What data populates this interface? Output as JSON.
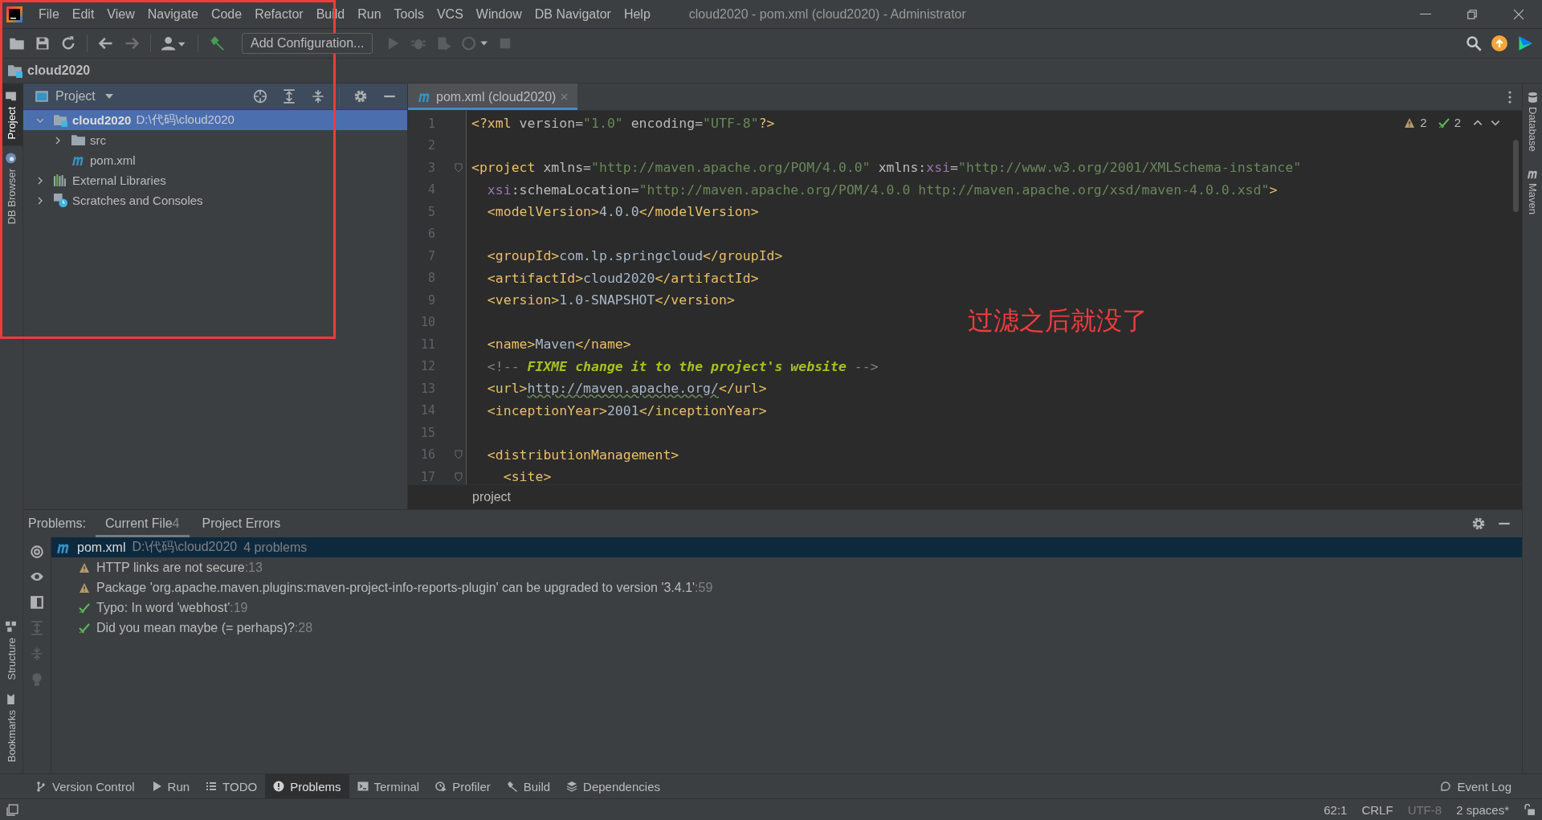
{
  "window": {
    "title": "cloud2020 - pom.xml (cloud2020) - Administrator"
  },
  "menu": [
    "File",
    "Edit",
    "View",
    "Navigate",
    "Code",
    "Refactor",
    "Build",
    "Run",
    "Tools",
    "VCS",
    "Window",
    "DB Navigator",
    "Help"
  ],
  "toolbar": {
    "run_config": "Add Configuration..."
  },
  "nav_bar": {
    "path": "cloud2020"
  },
  "left_stripe": {
    "top": [
      {
        "label": "Project",
        "selected": true,
        "kind": "folder"
      },
      {
        "label": "DB Browser",
        "selected": false,
        "kind": "db"
      }
    ],
    "bottom": [
      {
        "label": "Structure",
        "selected": false,
        "kind": "structure"
      },
      {
        "label": "Bookmarks",
        "selected": false,
        "kind": "bookmark"
      }
    ]
  },
  "right_stripe": [
    {
      "label": "Database",
      "kind": "db"
    },
    {
      "label": "Maven",
      "kind": "maven"
    }
  ],
  "project_panel": {
    "title": "Project",
    "tree": [
      {
        "label": "cloud2020",
        "path": "D:\\代码\\cloud2020",
        "kind": "module",
        "expanded": true,
        "selected": true,
        "children": [
          {
            "label": "src",
            "kind": "folder",
            "expanded": false,
            "selected": false
          },
          {
            "label": "pom.xml",
            "kind": "maven",
            "selected": false
          }
        ]
      },
      {
        "label": "External Libraries",
        "kind": "libraries",
        "expanded": false,
        "selected": false
      },
      {
        "label": "Scratches and Consoles",
        "kind": "scratches",
        "expanded": false,
        "selected": false
      }
    ]
  },
  "editor": {
    "tabs": [
      {
        "label": "pom.xml (cloud2020)",
        "selected": true
      }
    ],
    "warnings": "2",
    "typos": "2",
    "breadcrumb": "project",
    "lines": [
      {
        "number": "1",
        "fold": false,
        "tokens": [
          {
            "kind": "tag",
            "text": "<?xml"
          },
          {
            "kind": "attr",
            "text": " version="
          },
          {
            "kind": "value",
            "text": "\"1.0\""
          },
          {
            "kind": "attr",
            "text": " encoding="
          },
          {
            "kind": "value",
            "text": "\"UTF-8\""
          },
          {
            "kind": "tag",
            "text": "?>"
          }
        ]
      },
      {
        "number": "2",
        "fold": false
      },
      {
        "number": "3",
        "fold": true,
        "tokens": [
          {
            "kind": "tag",
            "text": "<project"
          },
          {
            "kind": "attr",
            "text": " xmlns="
          },
          {
            "kind": "value",
            "text": "\"http://maven.apache.org/POM/4.0.0\""
          },
          {
            "kind": "attr",
            "text": " xmlns:"
          },
          {
            "kind": "ns",
            "text": "xsi"
          },
          {
            "kind": "attr",
            "text": "="
          },
          {
            "kind": "value",
            "text": "\"http://www.w3.org/2001/XMLSchema-instance\""
          }
        ]
      },
      {
        "number": "4",
        "fold": false,
        "tokens": [
          {
            "kind": "ns",
            "text": "  xsi"
          },
          {
            "kind": "attr",
            "text": ":schemaLocation="
          },
          {
            "kind": "value",
            "text": "\"http://maven.apache.org/POM/4.0.0 http://maven.apache.org/xsd/maven-4.0.0.xsd\""
          },
          {
            "kind": "tag",
            "text": ">"
          }
        ]
      },
      {
        "number": "5",
        "fold": false,
        "tokens": [
          {
            "kind": "tag",
            "text": "  <modelVersion>"
          },
          {
            "kind": "text",
            "text": "4.0.0"
          },
          {
            "kind": "tag",
            "text": "</modelVersion>"
          }
        ]
      },
      {
        "number": "6",
        "fold": false
      },
      {
        "number": "7",
        "fold": false,
        "tokens": [
          {
            "kind": "tag",
            "text": "  <groupId>"
          },
          {
            "kind": "text",
            "text": "com.lp.springcloud"
          },
          {
            "kind": "tag",
            "text": "</groupId>"
          }
        ]
      },
      {
        "number": "8",
        "fold": false,
        "tokens": [
          {
            "kind": "tag",
            "text": "  <artifactId>"
          },
          {
            "kind": "text",
            "text": "cloud2020"
          },
          {
            "kind": "tag",
            "text": "</artifactId>"
          }
        ]
      },
      {
        "number": "9",
        "fold": false,
        "tokens": [
          {
            "kind": "tag",
            "text": "  <version>"
          },
          {
            "kind": "text",
            "text": "1.0-SNAPSHOT"
          },
          {
            "kind": "tag",
            "text": "</version>"
          }
        ]
      },
      {
        "number": "10",
        "fold": false
      },
      {
        "number": "11",
        "fold": false,
        "tokens": [
          {
            "kind": "tag",
            "text": "  <name>"
          },
          {
            "kind": "text",
            "text": "Maven"
          },
          {
            "kind": "tag",
            "text": "</name>"
          }
        ]
      },
      {
        "number": "12",
        "fold": false,
        "tokens": [
          {
            "kind": "comment",
            "text": "  <!-- "
          },
          {
            "kind": "todo",
            "text": "FIXME change it to the project's website"
          },
          {
            "kind": "comment",
            "text": " -->"
          }
        ]
      },
      {
        "number": "13",
        "fold": false,
        "tokens": [
          {
            "kind": "tag",
            "text": "  <url>"
          },
          {
            "kind": "url",
            "text": "http://maven.apache.org/"
          },
          {
            "kind": "tag",
            "text": "</url>"
          }
        ]
      },
      {
        "number": "14",
        "fold": false,
        "tokens": [
          {
            "kind": "tag",
            "text": "  <inceptionYear>"
          },
          {
            "kind": "text",
            "text": "2001"
          },
          {
            "kind": "tag",
            "text": "</inceptionYear>"
          }
        ]
      },
      {
        "number": "15",
        "fold": false
      },
      {
        "number": "16",
        "fold": true,
        "tokens": [
          {
            "kind": "tag",
            "text": "  <distributionManagement>"
          }
        ]
      },
      {
        "number": "17",
        "fold": true,
        "tokens": [
          {
            "kind": "tag",
            "text": "    <site>"
          }
        ]
      }
    ]
  },
  "annotation": {
    "text": "过滤之后就没了"
  },
  "problems": {
    "label": "Problems:",
    "tabs": [
      {
        "label": "Current File",
        "count": "4",
        "selected": true
      },
      {
        "label": "Project Errors",
        "selected": false
      }
    ],
    "file": {
      "name": "pom.xml",
      "path": "D:\\代码\\cloud2020",
      "summary": "4 problems",
      "selected": true
    },
    "items": [
      {
        "kind": "warning",
        "text": "HTTP links are not secure",
        "line": ":13"
      },
      {
        "kind": "warning",
        "text": "Package 'org.apache.maven.plugins:maven-project-info-reports-plugin' can be upgraded to version '3.4.1'",
        "line": ":59"
      },
      {
        "kind": "typo",
        "text": "Typo: In word 'webhost'",
        "line": ":19"
      },
      {
        "kind": "typo",
        "text": "Did you mean maybe (= perhaps)?",
        "line": ":28"
      }
    ]
  },
  "tool_windows": [
    {
      "label": "Version Control",
      "kind": "branch",
      "selected": false
    },
    {
      "label": "Run",
      "kind": "run",
      "selected": false
    },
    {
      "label": "TODO",
      "kind": "list",
      "selected": false
    },
    {
      "label": "Problems",
      "kind": "problems",
      "selected": true
    },
    {
      "label": "Terminal",
      "kind": "terminal",
      "selected": false
    },
    {
      "label": "Profiler",
      "kind": "profiler",
      "selected": false
    },
    {
      "label": "Build",
      "kind": "hammer",
      "selected": false
    },
    {
      "label": "Dependencies",
      "kind": "layers",
      "selected": false
    }
  ],
  "event_log": "Event Log",
  "status_bar": {
    "items": [
      {
        "text": "62:1",
        "disabled": false
      },
      {
        "text": "CRLF",
        "disabled": false
      },
      {
        "text": "UTF-8",
        "disabled": true
      },
      {
        "text": "2 spaces*",
        "disabled": false
      }
    ]
  }
}
